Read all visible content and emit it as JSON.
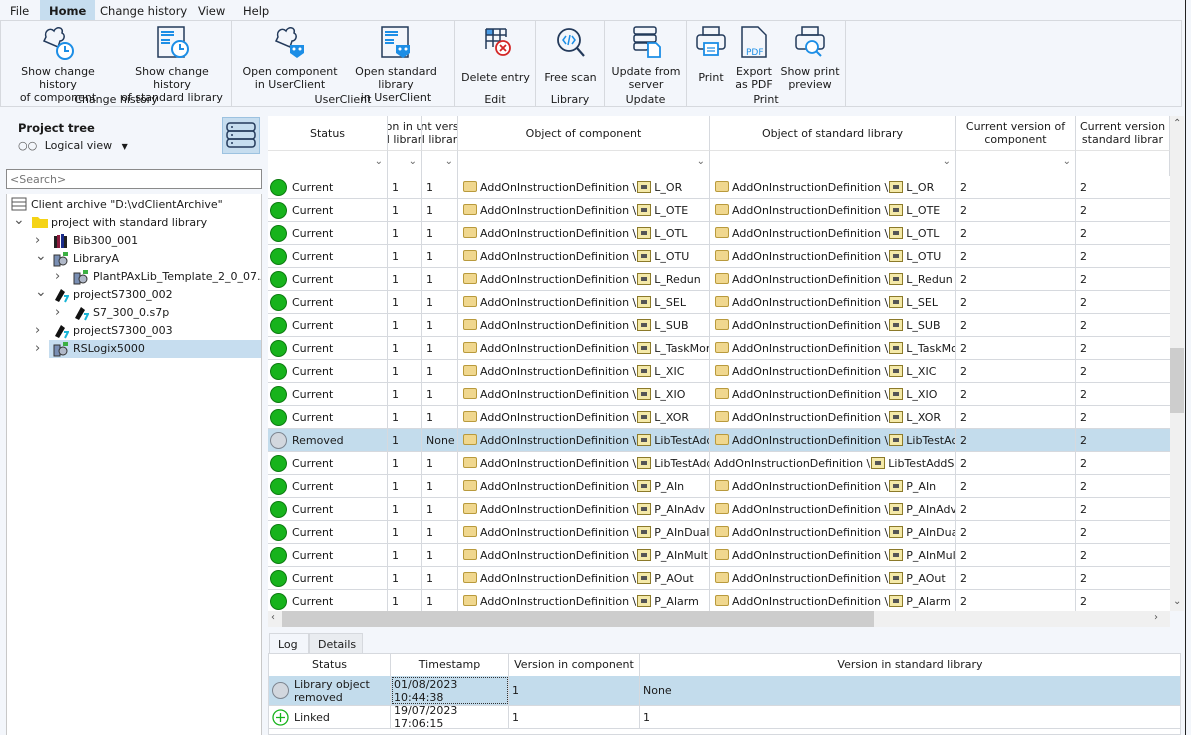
{
  "menu": [
    "File",
    "Home",
    "Change history",
    "View",
    "Help"
  ],
  "menu_active": "Home",
  "ribbon": {
    "groups": [
      {
        "label": "Change history",
        "buttons": [
          {
            "label1": "Show change history",
            "label2": "of component",
            "icon": "puzzle-clock-icon"
          },
          {
            "label1": "Show change history",
            "label2": "of standard library",
            "icon": "library-clock-icon"
          }
        ]
      },
      {
        "label": "UserClient",
        "buttons": [
          {
            "label1": "Open component",
            "label2": "in UserClient",
            "icon": "puzzle-userclient-icon"
          },
          {
            "label1": "Open standard library",
            "label2": "in UserClient",
            "icon": "library-userclient-icon"
          }
        ]
      },
      {
        "label": "Edit",
        "buttons": [
          {
            "label1": "Delete entry",
            "label2": "",
            "icon": "grid-delete-icon"
          }
        ]
      },
      {
        "label": "Library",
        "buttons": [
          {
            "label1": "Free scan",
            "label2": "",
            "icon": "code-search-icon"
          }
        ]
      },
      {
        "label": "Update",
        "buttons": [
          {
            "label1": "Update from",
            "label2": "server",
            "icon": "server-document-icon"
          }
        ]
      },
      {
        "label": "Print",
        "buttons": [
          {
            "label1": "Print",
            "label2": "",
            "icon": "printer-icon"
          },
          {
            "label1": "Export",
            "label2": "as PDF",
            "icon": "pdf-icon"
          },
          {
            "label1": "Show print",
            "label2": "preview",
            "icon": "print-preview-icon"
          }
        ]
      }
    ]
  },
  "project_tree": {
    "title": "Project tree",
    "view": "Logical view",
    "search_placeholder": "<Search>",
    "nodes": [
      {
        "label": "Client archive \"D:\\vdClientArchive\"",
        "level": 0,
        "expander": "",
        "icon": "archive-icon"
      },
      {
        "label": "project with standard library",
        "level": 0,
        "expander": "expanded",
        "icon": "folder-icon"
      },
      {
        "label": "Bib300_001",
        "level": 1,
        "expander": "collapsed",
        "icon": "books-icon"
      },
      {
        "label": "LibraryA",
        "level": 1,
        "expander": "expanded",
        "icon": "rslogix-icon"
      },
      {
        "label": "PlantPAxLib_Template_2_0_07.ACD",
        "level": 2,
        "expander": "collapsed",
        "icon": "rslogix-icon"
      },
      {
        "label": "projectS7300_002",
        "level": 1,
        "expander": "expanded",
        "icon": "step7-icon"
      },
      {
        "label": "S7_300_0.s7p",
        "level": 2,
        "expander": "collapsed",
        "icon": "step7-icon"
      },
      {
        "label": "projectS7300_003",
        "level": 1,
        "expander": "collapsed",
        "icon": "step7-icon"
      },
      {
        "label": "RSLogix5000",
        "level": 1,
        "expander": "collapsed",
        "icon": "rslogix-icon",
        "selected": true
      }
    ]
  },
  "grid": {
    "columns": [
      "Status",
      "on in u\nl librar",
      "nt vers\nl librar",
      "Object of component",
      "Object of standard library",
      "Current version of\ncomponent",
      "Current version\nstandard librar"
    ],
    "rows": [
      {
        "status": "Current",
        "v1": "1",
        "v2": "1",
        "obj_comp": "L_OR",
        "obj_lib": "L_OR",
        "cur_comp": "2",
        "cur_lib": "2"
      },
      {
        "status": "Current",
        "v1": "1",
        "v2": "1",
        "obj_comp": "L_OTE",
        "obj_lib": "L_OTE",
        "cur_comp": "2",
        "cur_lib": "2"
      },
      {
        "status": "Current",
        "v1": "1",
        "v2": "1",
        "obj_comp": "L_OTL",
        "obj_lib": "L_OTL",
        "cur_comp": "2",
        "cur_lib": "2"
      },
      {
        "status": "Current",
        "v1": "1",
        "v2": "1",
        "obj_comp": "L_OTU",
        "obj_lib": "L_OTU",
        "cur_comp": "2",
        "cur_lib": "2"
      },
      {
        "status": "Current",
        "v1": "1",
        "v2": "1",
        "obj_comp": "L_Redun",
        "obj_lib": "L_Redun",
        "cur_comp": "2",
        "cur_lib": "2"
      },
      {
        "status": "Current",
        "v1": "1",
        "v2": "1",
        "obj_comp": "L_SEL",
        "obj_lib": "L_SEL",
        "cur_comp": "2",
        "cur_lib": "2"
      },
      {
        "status": "Current",
        "v1": "1",
        "v2": "1",
        "obj_comp": "L_SUB",
        "obj_lib": "L_SUB",
        "cur_comp": "2",
        "cur_lib": "2"
      },
      {
        "status": "Current",
        "v1": "1",
        "v2": "1",
        "obj_comp": "L_TaskMon",
        "obj_lib": "L_TaskMon",
        "cur_comp": "2",
        "cur_lib": "2"
      },
      {
        "status": "Current",
        "v1": "1",
        "v2": "1",
        "obj_comp": "L_XIC",
        "obj_lib": "L_XIC",
        "cur_comp": "2",
        "cur_lib": "2"
      },
      {
        "status": "Current",
        "v1": "1",
        "v2": "1",
        "obj_comp": "L_XIO",
        "obj_lib": "L_XIO",
        "cur_comp": "2",
        "cur_lib": "2"
      },
      {
        "status": "Current",
        "v1": "1",
        "v2": "1",
        "obj_comp": "L_XOR",
        "obj_lib": "L_XOR",
        "cur_comp": "2",
        "cur_lib": "2"
      },
      {
        "status": "Removed",
        "v1": "1",
        "v2": "None",
        "obj_comp": "LibTestAdd",
        "obj_lib": "LibTestAdd",
        "cur_comp": "2",
        "cur_lib": "2",
        "selected": true
      },
      {
        "status": "Current",
        "v1": "1",
        "v2": "1",
        "obj_comp": "LibTestAddSec",
        "obj_lib": "LibTestAddSec",
        "cur_comp": "2",
        "cur_lib": "2",
        "no_folder": true
      },
      {
        "status": "Current",
        "v1": "1",
        "v2": "1",
        "obj_comp": "P_AIn",
        "obj_lib": "P_AIn",
        "cur_comp": "2",
        "cur_lib": "2"
      },
      {
        "status": "Current",
        "v1": "1",
        "v2": "1",
        "obj_comp": "P_AInAdv",
        "obj_lib": "P_AInAdv",
        "cur_comp": "2",
        "cur_lib": "2"
      },
      {
        "status": "Current",
        "v1": "1",
        "v2": "1",
        "obj_comp": "P_AInDual",
        "obj_lib": "P_AInDual",
        "cur_comp": "2",
        "cur_lib": "2"
      },
      {
        "status": "Current",
        "v1": "1",
        "v2": "1",
        "obj_comp": "P_AInMulti",
        "obj_lib": "P_AInMulti",
        "cur_comp": "2",
        "cur_lib": "2"
      },
      {
        "status": "Current",
        "v1": "1",
        "v2": "1",
        "obj_comp": "P_AOut",
        "obj_lib": "P_AOut",
        "cur_comp": "2",
        "cur_lib": "2"
      },
      {
        "status": "Current",
        "v1": "1",
        "v2": "1",
        "obj_comp": "P_Alarm",
        "obj_lib": "P_Alarm",
        "cur_comp": "2",
        "cur_lib": "2"
      }
    ],
    "path_prefix": "AddOnInstructionDefinition \\"
  },
  "bottom": {
    "tabs": [
      "Log",
      "Details"
    ],
    "active_tab": "Log",
    "columns": [
      "Status",
      "Timestamp",
      "Version in component",
      "Version in standard library"
    ],
    "rows": [
      {
        "status": "Library object removed",
        "timestamp": "01/08/2023 10:44:38",
        "ver_comp": "1",
        "ver_lib": "None",
        "icon": "removed-circle-icon",
        "selected": true
      },
      {
        "status": "Linked",
        "timestamp": "19/07/2023 17:06:15",
        "ver_comp": "1",
        "ver_lib": "1",
        "icon": "linked-plus-icon"
      }
    ]
  },
  "colors": {
    "accent": "#1c74b6",
    "selection": "#c3dcec",
    "current": "#17b31c"
  }
}
